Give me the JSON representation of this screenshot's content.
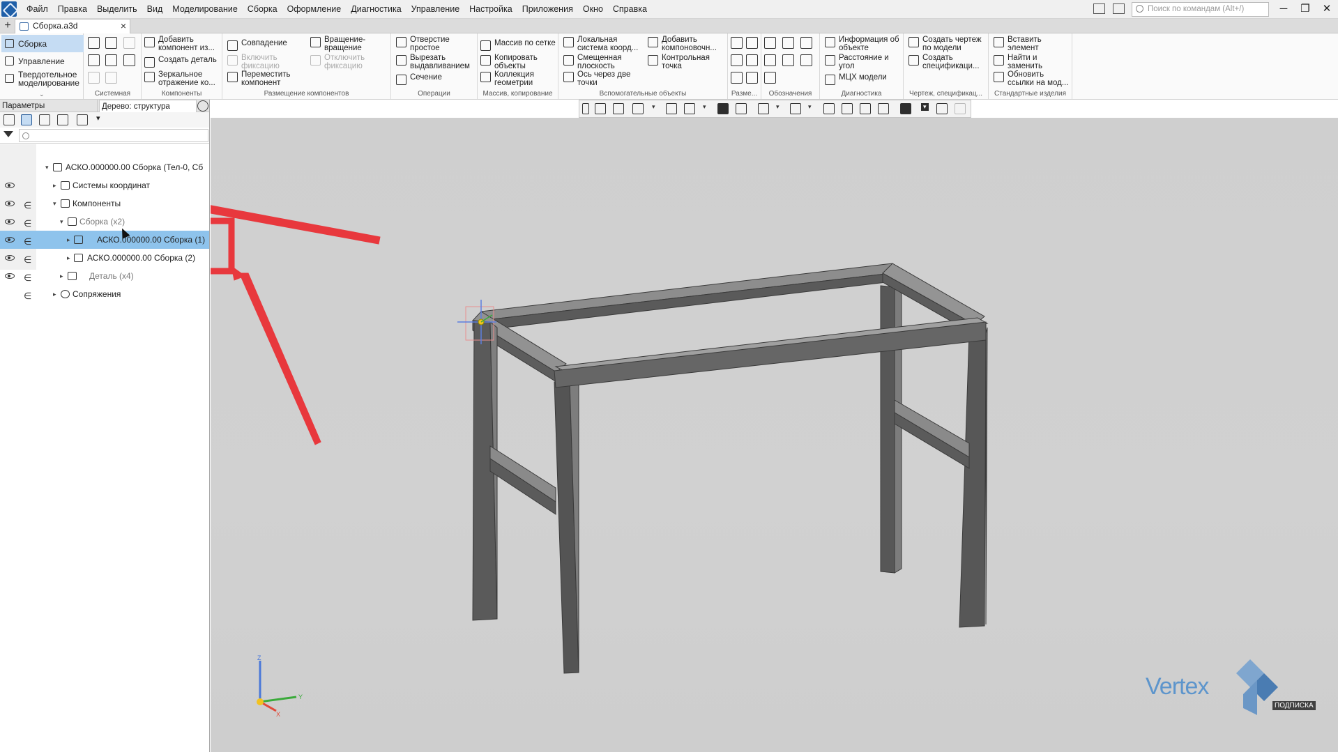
{
  "menubar": {
    "items": [
      "Файл",
      "Правка",
      "Выделить",
      "Вид",
      "Моделирование",
      "Сборка",
      "Оформление",
      "Диагностика",
      "Управление",
      "Настройка",
      "Приложения",
      "Окно",
      "Справка"
    ],
    "search_placeholder": "Поиск по командам (Alt+/)"
  },
  "window": {
    "minimize": "─",
    "restore": "❐",
    "close": "✕"
  },
  "tabs": {
    "new_tab": "+",
    "document": "Сборка.a3d",
    "close": "×"
  },
  "ribbon": {
    "modes": [
      "Сборка",
      "Управление",
      "Твердотельное\nмоделирование"
    ],
    "mode_more": "⌄",
    "groups": {
      "system": "Системная",
      "components": "Компоненты",
      "placement": "Размещение компонентов",
      "operations": "Операции",
      "array": "Массив, копирование",
      "aux": "Вспомогательные объекты",
      "dims": "Разме...",
      "annotations": "Обозначения",
      "diagnostics": "Диагностика",
      "drawing": "Чертеж, спецификац...",
      "standard": "Стандартные изделия"
    },
    "buttons": {
      "add_component": "Добавить\nкомпонент из...",
      "create_part": "Создать деталь",
      "mirror": "Зеркальное\nотражение ко...",
      "coincidence": "Совпадение",
      "enable_fix": "Включить\nфиксацию",
      "move_component": "Переместить\nкомпонент",
      "rotate": "Вращение-\nвращение",
      "disable_fix": "Отключить\nфиксацию",
      "hole": "Отверстие\nпростое",
      "cut_extrude": "Вырезать\nвыдавливанием",
      "section": "Сечение",
      "grid_array": "Массив по сетке",
      "copy_objects": "Копировать\nобъекты",
      "geometry_collection": "Коллекция\nгеометрии",
      "local_cs": "Локальная\nсистема коорд...",
      "offset_plane": "Смещенная\nплоскость",
      "axis_two_points": "Ось через две\nточки",
      "add_layout": "Добавить\nкомпоновочн...",
      "control_point": "Контрольная\nточка",
      "object_info": "Информация об\nобъекте",
      "distance_angle": "Расстояние и\nугол",
      "mass_props": "МЦХ модели",
      "create_drawing": "Создать чертеж\nпо модели",
      "create_spec": "Создать\nспецификаци...",
      "insert_element": "Вставить\nэлемент",
      "find_replace": "Найти и\nзаменить",
      "update_links": "Обновить\nссылки на мод..."
    }
  },
  "left_panel": {
    "tab_params": "Параметры",
    "tab_tree": "Дерево: структура",
    "tree": [
      {
        "label": "АСКО.000000.00 Сборка (Тел-0, Сб",
        "level": 0,
        "caret": "▾"
      },
      {
        "label": "Системы координат",
        "level": 1,
        "caret": "▸"
      },
      {
        "label": "Компоненты",
        "level": 1,
        "caret": "▾"
      },
      {
        "label": "Сборка (х2)",
        "level": 2,
        "caret": "▾"
      },
      {
        "label": "АСКО.000000.00 Сборка (1)",
        "level": 3,
        "caret": "▸"
      },
      {
        "label": "АСКО.000000.00 Сборка (2)",
        "level": 3,
        "caret": "▸"
      },
      {
        "label": "Деталь (х4)",
        "level": 2,
        "caret": "▸"
      },
      {
        "label": "Сопряжения",
        "level": 1,
        "caret": "▸"
      }
    ],
    "include_glyph": "∈"
  },
  "view_toolbar": {
    "dropdown_glyph": "▾"
  },
  "axis_labels": {
    "z": "Z",
    "y": "Y",
    "x": "X"
  },
  "watermark": {
    "brand": "Vertex",
    "sub": "ПОДПИСКА"
  },
  "colors": {
    "selection": "#8ec3ec",
    "accent": "#e8383d",
    "viewport_bg": "#cfcfcf",
    "frame": "#6a6a6a"
  }
}
